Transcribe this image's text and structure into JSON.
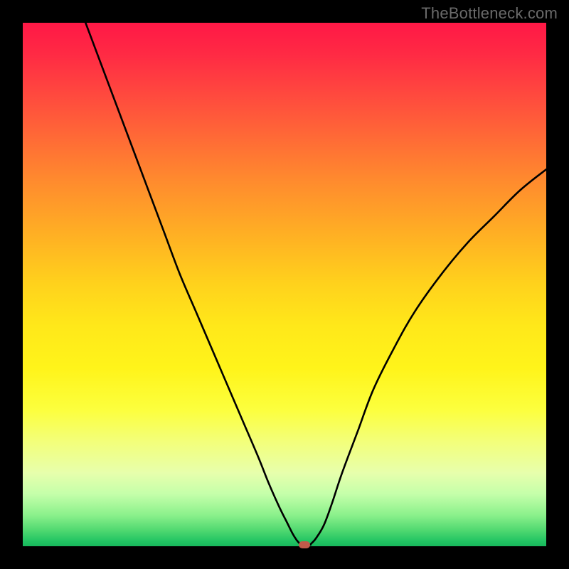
{
  "watermark": "TheBottleneck.com",
  "colors": {
    "curve": "#000000",
    "dot": "#c15a4a",
    "frame": "#000000"
  },
  "chart_data": {
    "type": "line",
    "title": "",
    "xlabel": "",
    "ylabel": "",
    "xlim": [
      0,
      100
    ],
    "ylim": [
      0,
      100
    ],
    "series": [
      {
        "name": "curve-left",
        "x": [
          12,
          15,
          18,
          21,
          24,
          27,
          30,
          33,
          36,
          39,
          42,
          45,
          47,
          49,
          50.5,
          51.5,
          52.3,
          53
        ],
        "y": [
          100,
          92,
          84,
          76,
          68,
          60,
          52,
          45,
          38,
          31,
          24,
          17,
          12,
          7.5,
          4.5,
          2.5,
          1.2,
          0.4
        ]
      },
      {
        "name": "curve-right",
        "x": [
          55,
          56,
          57.5,
          59,
          61,
          64,
          67,
          71,
          75,
          80,
          85,
          90,
          95,
          100
        ],
        "y": [
          0.4,
          1.5,
          4,
          8,
          14,
          22,
          30,
          38,
          45,
          52,
          58,
          63,
          68,
          72
        ]
      },
      {
        "name": "floor",
        "x": [
          53,
          55
        ],
        "y": [
          0.3,
          0.3
        ]
      }
    ],
    "marker": {
      "x": 53.8,
      "y": 0.3,
      "shape": "rounded-rect",
      "color": "#c15a4a"
    }
  }
}
